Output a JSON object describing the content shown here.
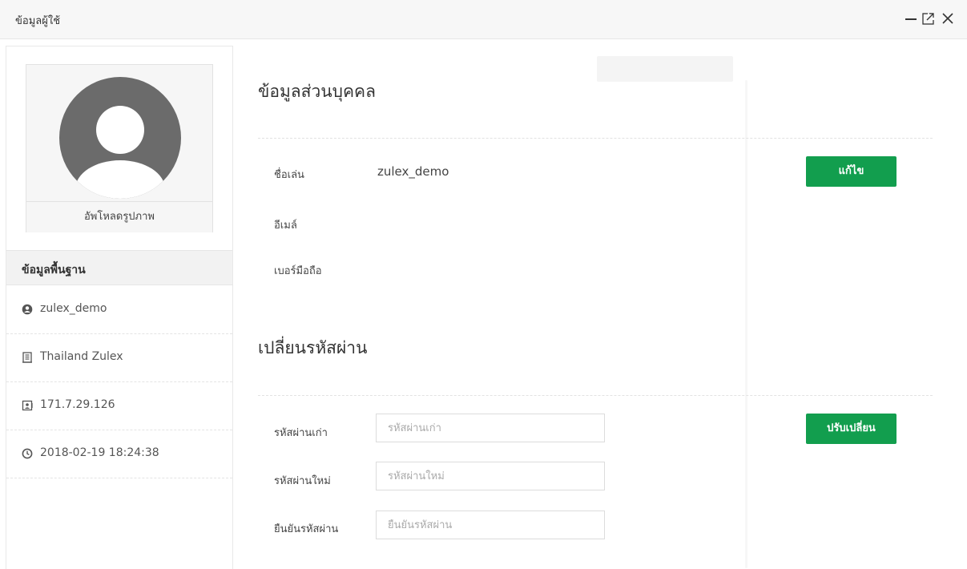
{
  "window": {
    "title": "ข้อมูลผู้ใช้",
    "minimize_icon": "minimize-icon",
    "maximize_icon": "maximize-icon",
    "close_icon": "close-icon"
  },
  "sidebar": {
    "upload_label": "อัพโหลดรูปภาพ",
    "basic_info_title": "ข้อมูลพื้นฐาน",
    "items": [
      {
        "icon": "user-circle-icon",
        "text": "zulex_demo"
      },
      {
        "icon": "building-icon",
        "text": "Thailand Zulex"
      },
      {
        "icon": "ip-card-icon",
        "text": "171.7.29.126"
      },
      {
        "icon": "clock-icon",
        "text": "2018-02-19 18:24:38"
      }
    ]
  },
  "personal": {
    "title": "ข้อมูลส่วนบุคคล",
    "nickname_label": "ชื่อเล่น",
    "nickname_value": "zulex_demo",
    "email_label": "อีเมล์",
    "phone_label": "เบอร์มือถือ",
    "edit_button": "แก้ไข"
  },
  "password": {
    "title": "เปลี่ยนรหัสผ่าน",
    "old_label": "รหัสผ่านเก่า",
    "old_placeholder": "รหัสผ่านเก่า",
    "new_label": "รหัสผ่านใหม่",
    "new_placeholder": "รหัสผ่านใหม่",
    "confirm_label": "ยืนยันรหัสผ่าน",
    "confirm_placeholder": "ยืนยันรหัสผ่าน",
    "change_button": "ปรับเปลี่ยน"
  },
  "colors": {
    "accent": "#129e4e",
    "avatar": "#6b6b6b"
  }
}
